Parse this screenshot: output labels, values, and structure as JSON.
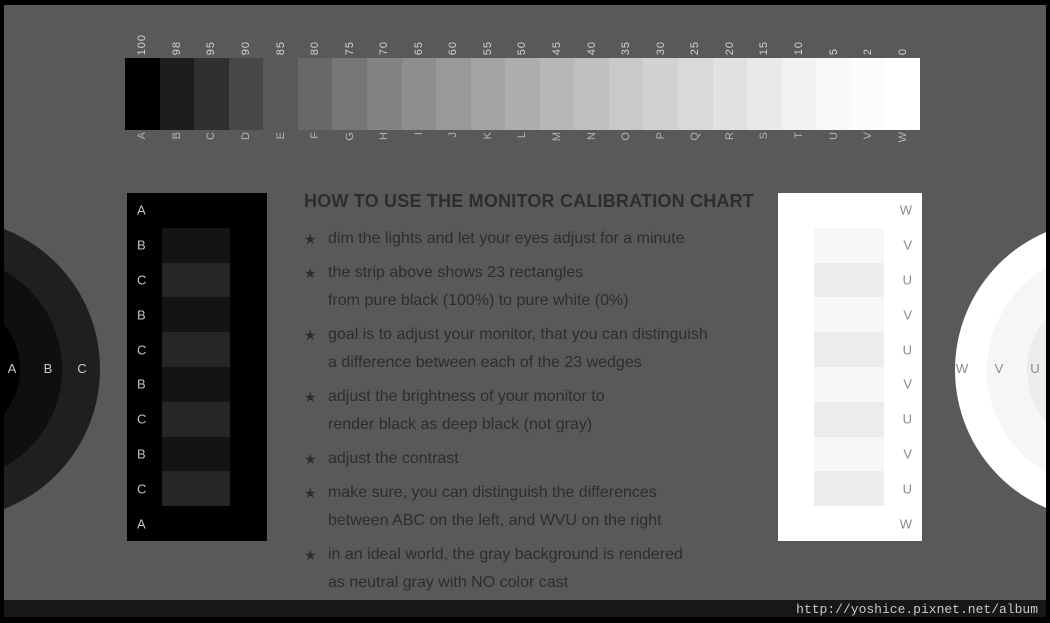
{
  "strip": {
    "percent_labels": [
      "100",
      "98",
      "95",
      "90",
      "85",
      "80",
      "75",
      "70",
      "65",
      "60",
      "55",
      "50",
      "45",
      "40",
      "35",
      "30",
      "25",
      "20",
      "15",
      "10",
      "5",
      "2",
      "0"
    ],
    "letter_labels": [
      "A",
      "B",
      "C",
      "D",
      "E",
      "F",
      "G",
      "H",
      "I",
      "J",
      "K",
      "L",
      "M",
      "N",
      "O",
      "P",
      "Q",
      "R",
      "S",
      "T",
      "U",
      "V",
      "W"
    ]
  },
  "left_panel": {
    "rows": [
      "A",
      "B",
      "C",
      "B",
      "C",
      "B",
      "C",
      "B",
      "C",
      "A"
    ]
  },
  "right_panel": {
    "rows": [
      "W",
      "V",
      "U",
      "V",
      "U",
      "V",
      "U",
      "V",
      "U",
      "W"
    ]
  },
  "instructions": {
    "title": "HOW TO USE THE MONITOR CALIBRATION CHART",
    "bullet_icon": "★",
    "bullets": [
      {
        "lines": [
          "dim the lights and let your eyes adjust for a minute"
        ]
      },
      {
        "lines": [
          "the strip above shows 23 rectangles",
          "from pure black (100%) to pure white (0%)"
        ]
      },
      {
        "lines": [
          "goal is to adjust your monitor, that you can distinguish",
          "a difference between each of the 23 wedges"
        ]
      },
      {
        "lines": [
          "adjust the brightness of your monitor to",
          "render black as deep black (not gray)"
        ]
      },
      {
        "lines": [
          "adjust the contrast"
        ]
      },
      {
        "lines": [
          "make sure, you can distinguish the differences",
          "between ABC on the left, and WVU on the right"
        ]
      },
      {
        "lines": [
          "in an ideal world, the gray background is rendered",
          "as neutral gray with NO color cast"
        ]
      }
    ]
  },
  "rings_left": {
    "labels": [
      "A",
      "B",
      "C"
    ]
  },
  "rings_right": {
    "labels": [
      "W",
      "V",
      "U"
    ]
  },
  "footer": {
    "url": "http://yoshice.pixnet.net/album"
  },
  "colors": {
    "canvas_bg": "#595959",
    "frame": "#000000",
    "ink": "#2d2d2d",
    "shade_b": "#141414",
    "shade_c": "#262626",
    "shade_v": "#f7f7f7",
    "shade_u": "#ececec",
    "url_bg": "#171717",
    "url_text": "#c8c8c8"
  }
}
